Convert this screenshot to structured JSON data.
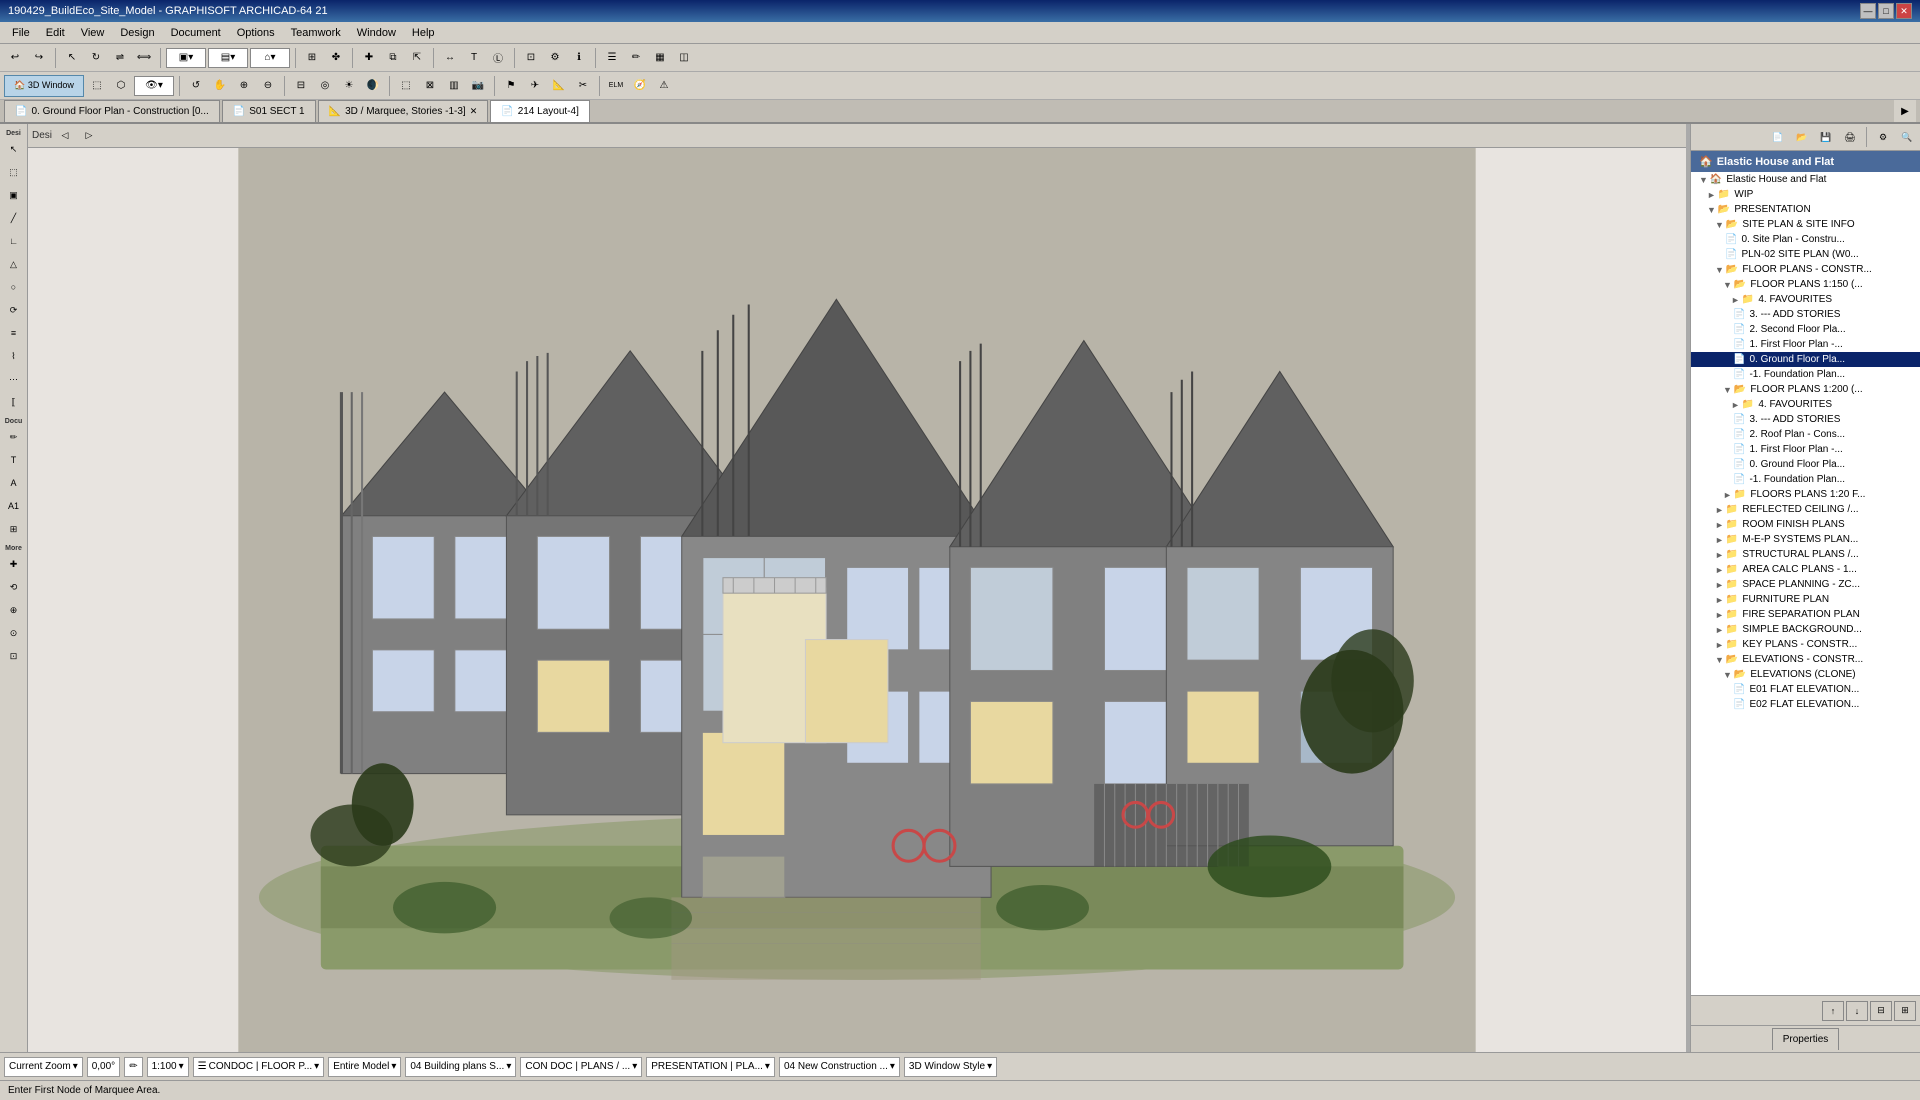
{
  "titlebar": {
    "title": "190429_BuildEco_Site_Model - GRAPHISOFT ARCHICAD-64 21",
    "controls": [
      "—",
      "□",
      "✕"
    ]
  },
  "menubar": {
    "items": [
      "File",
      "Edit",
      "View",
      "Design",
      "Document",
      "Options",
      "Teamwork",
      "Window",
      "Help"
    ]
  },
  "tabs": [
    {
      "id": "tab1",
      "label": "0. Ground Floor Plan - Construction [0...",
      "icon": "📄",
      "active": false,
      "closable": false
    },
    {
      "id": "tab2",
      "label": "S01 SECT 1",
      "icon": "📄",
      "active": false,
      "closable": false
    },
    {
      "id": "tab3",
      "label": "3D / Marquee, Stories -1-3]",
      "icon": "📐",
      "active": false,
      "closable": true
    },
    {
      "id": "tab4",
      "label": "214 Layout-4]",
      "icon": "📄",
      "active": true,
      "closable": false
    }
  ],
  "left_toolbar": {
    "sections": [
      {
        "label": "Desi",
        "tools": [
          "↖",
          "⬚",
          "⬛",
          "╱",
          "∟",
          "△",
          "○",
          "⟳",
          "≡",
          "⌇",
          "⋯",
          "Ⓣ"
        ]
      },
      {
        "label": "Docu",
        "tools": [
          "✏",
          "📝",
          "🖊",
          "A",
          "A1"
        ]
      },
      {
        "label": "More",
        "tools": [
          "✚",
          "⟲",
          "⊕",
          "⊙",
          "⊡"
        ]
      }
    ]
  },
  "viewport": {
    "background_color": "#b8b4a8"
  },
  "right_panel": {
    "project_name": "Elastic House and Flat",
    "tree": [
      {
        "level": 0,
        "type": "project",
        "label": "Elastic House and Flat",
        "expanded": true
      },
      {
        "level": 1,
        "type": "folder",
        "label": "WIP",
        "expanded": false
      },
      {
        "level": 1,
        "type": "folder",
        "label": "PRESENTATION",
        "expanded": true
      },
      {
        "level": 2,
        "type": "folder",
        "label": "SITE PLAN & SITE INFO",
        "expanded": true
      },
      {
        "level": 3,
        "type": "file",
        "label": "0. Site Plan - Constru..."
      },
      {
        "level": 3,
        "type": "file",
        "label": "PLN-02 SITE PLAN (W0..."
      },
      {
        "level": 2,
        "type": "folder",
        "label": "FLOOR PLANS - CONSTR...",
        "expanded": true
      },
      {
        "level": 3,
        "type": "folder",
        "label": "FLOOR PLANS 1:150 (...",
        "expanded": true
      },
      {
        "level": 4,
        "type": "folder",
        "label": "4. FAVOURITES",
        "expanded": false
      },
      {
        "level": 4,
        "type": "file",
        "label": "3. --- ADD STORIES"
      },
      {
        "level": 4,
        "type": "file",
        "label": "2. Second Floor Pla..."
      },
      {
        "level": 4,
        "type": "file",
        "label": "1. First Floor Plan -..."
      },
      {
        "level": 4,
        "type": "file",
        "label": "0. Ground Floor Pla...",
        "selected": true
      },
      {
        "level": 4,
        "type": "file",
        "label": "-1. Foundation Plan..."
      },
      {
        "level": 3,
        "type": "folder",
        "label": "FLOOR PLANS 1:200 (...",
        "expanded": true
      },
      {
        "level": 4,
        "type": "folder",
        "label": "4. FAVOURITES",
        "expanded": false
      },
      {
        "level": 4,
        "type": "file",
        "label": "3. --- ADD STORIES"
      },
      {
        "level": 4,
        "type": "file",
        "label": "2. Roof Plan - Cons..."
      },
      {
        "level": 4,
        "type": "file",
        "label": "1. First Floor Plan -..."
      },
      {
        "level": 4,
        "type": "file",
        "label": "0. Ground Floor Pla..."
      },
      {
        "level": 4,
        "type": "file",
        "label": "-1. Foundation Plan..."
      },
      {
        "level": 3,
        "type": "folder",
        "label": "FLOORS PLANS 1:20 F...",
        "expanded": false
      },
      {
        "level": 2,
        "type": "folder",
        "label": "REFLECTED CEILING /...",
        "expanded": false
      },
      {
        "level": 2,
        "type": "folder",
        "label": "ROOM FINISH PLANS",
        "expanded": false
      },
      {
        "level": 2,
        "type": "folder",
        "label": "M-E-P SYSTEMS PLAN...",
        "expanded": false
      },
      {
        "level": 2,
        "type": "folder",
        "label": "STRUCTURAL PLANS /...",
        "expanded": false
      },
      {
        "level": 2,
        "type": "folder",
        "label": "AREA CALC PLANS - 1...",
        "expanded": false
      },
      {
        "level": 2,
        "type": "folder",
        "label": "SPACE PLANNING - ZC...",
        "expanded": false
      },
      {
        "level": 2,
        "type": "folder",
        "label": "FURNITURE PLAN",
        "expanded": false
      },
      {
        "level": 2,
        "type": "folder",
        "label": "FIRE SEPARATION PLAN",
        "expanded": false
      },
      {
        "level": 2,
        "type": "folder",
        "label": "SIMPLE BACKGROUND...",
        "expanded": false
      },
      {
        "level": 2,
        "type": "folder",
        "label": "KEY PLANS - CONSTR...",
        "expanded": false
      },
      {
        "level": 2,
        "type": "folder",
        "label": "ELEVATIONS - CONSTR...",
        "expanded": true
      },
      {
        "level": 3,
        "type": "folder",
        "label": "ELEVATIONS (CLONE)",
        "expanded": true
      },
      {
        "level": 4,
        "type": "file",
        "label": "E01 FLAT ELEVATION..."
      },
      {
        "level": 4,
        "type": "file",
        "label": "E02 FLAT ELEVATION..."
      }
    ],
    "properties_label": "Properties"
  },
  "statusbar": {
    "zoom_label": "Current Zoom",
    "zoom_value": "0,00°",
    "scale": "1:100",
    "layer": "CONDOC | FLOOR P...",
    "scope": "Entire Model",
    "plan": "04 Building plans S...",
    "doc": "CON DOC | PLANS / ...",
    "presentation": "PRESENTATION | PLA...",
    "construction": "04 New Construction ...",
    "style": "3D Window Style"
  },
  "infobar": {
    "message": "Enter First Node of Marquee Area."
  },
  "icons": {
    "arrow": "↖",
    "marquee": "⬚",
    "folder": "📁",
    "file": "📄",
    "chevron_right": "▶",
    "chevron_down": "▼",
    "triangle_right": "►",
    "triangle_down": "▼"
  }
}
